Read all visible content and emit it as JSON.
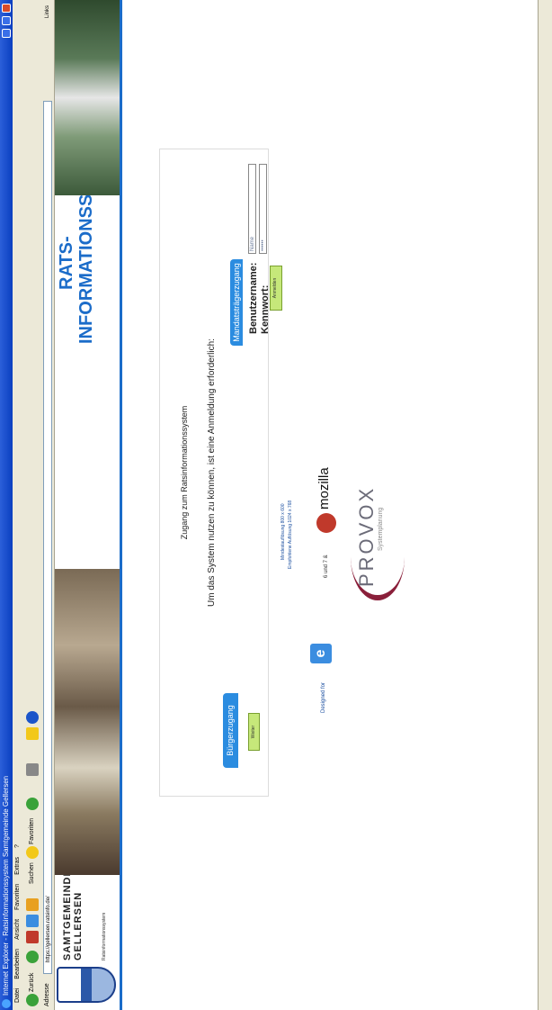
{
  "window": {
    "title": "Internet Explorer - Ratsinformationssystem Samtgemeinde Gellersen"
  },
  "menu": [
    "Datei",
    "Bearbeiten",
    "Ansicht",
    "Favoriten",
    "Extras",
    "?"
  ],
  "toolbar": {
    "back": "Zurück",
    "search": "Suchen",
    "favorites": "Favoriten"
  },
  "address": {
    "label": "Adresse",
    "url": "https://gellersen.ratsinfo.de/",
    "links": "Links"
  },
  "header": {
    "org_line1": "SAMTGEMEINDE",
    "org_line2": "GELLERSEN",
    "org_sub": "Ratsinformationssystem",
    "title_line1": "RATS-",
    "title_line2": "INFORMATIONSSYSTEM"
  },
  "login": {
    "heading": "Zugang zum Ratsinformationssystem",
    "hint": "Um das System nutzen zu können, ist eine Anmeldung erforderlich:",
    "citizen_tab": "Bürgerzugang",
    "citizen_button": "Weiter",
    "member_tab": "Mandatsträgerzugang",
    "username_label": "Benutzername:",
    "password_label": "Kennwort:",
    "username_value": "Name",
    "password_value": "••••••",
    "member_button": "Anmelden"
  },
  "footer": {
    "resolution_min": "Mindestauflösung 800 x 600",
    "resolution_rec": "Empfohlene Auflösung 1024 x 768",
    "designed_for": "Designed for",
    "ie_letter": "e",
    "and_text": "6 und 7 &",
    "mozilla": "mozilla",
    "provox": "PROVOX",
    "provox_sub": "Systemplanung"
  },
  "colors": {
    "accent": "#1b6cc9",
    "tab": "#2b8ce0",
    "button": "#c6e87a"
  }
}
